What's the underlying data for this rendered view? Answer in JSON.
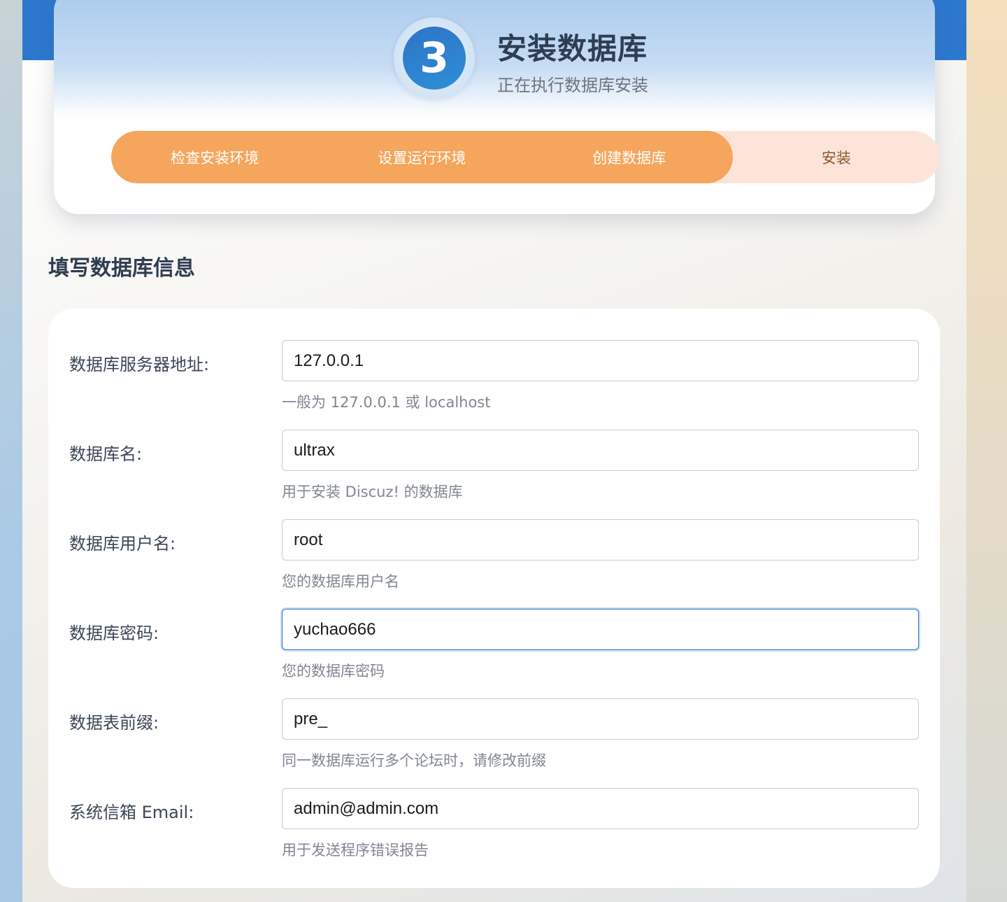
{
  "header": {
    "step_number": "3",
    "title": "安装数据库",
    "subtitle": "正在执行数据库安装"
  },
  "progress": {
    "steps": [
      "检查安装环境",
      "设置运行环境",
      "创建数据库",
      "安装"
    ],
    "completed_steps": 3,
    "colors": {
      "done": "#f6a55c",
      "todo": "#fde4d9"
    }
  },
  "section": {
    "title": "填写数据库信息"
  },
  "form": {
    "fields": [
      {
        "label": "数据库服务器地址:",
        "value": "127.0.0.1",
        "hint": "一般为 127.0.0.1 或 localhost"
      },
      {
        "label": "数据库名:",
        "value": "ultrax",
        "hint": "用于安装 Discuz! 的数据库"
      },
      {
        "label": "数据库用户名:",
        "value": "root",
        "hint": "您的数据库用户名"
      },
      {
        "label": "数据库密码:",
        "value": "yuchao666",
        "hint": "您的数据库密码"
      },
      {
        "label": "数据表前缀:",
        "value": "pre_",
        "hint": "同一数据库运行多个论坛时，请修改前缀"
      },
      {
        "label": "系统信箱 Email:",
        "value": "admin@admin.com",
        "hint": "用于发送程序错误报告"
      }
    ]
  },
  "colors": {
    "accent_blue": "#2d78cf",
    "accent_orange": "#f6a55c"
  }
}
